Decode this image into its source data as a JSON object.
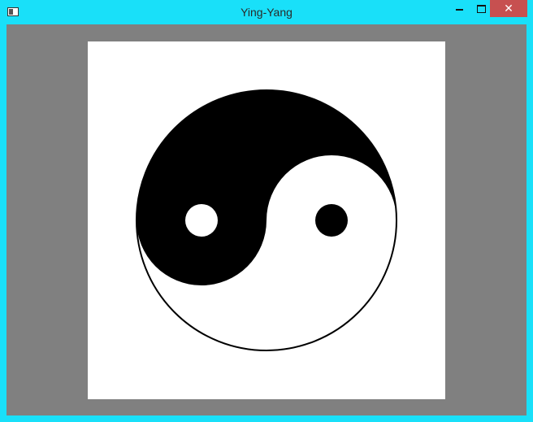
{
  "window": {
    "title": "Ying-Yang",
    "icons": {
      "app": "application-icon",
      "minimize": "minimize-icon",
      "maximize": "maximize-icon",
      "close": "close-icon"
    },
    "close_glyph": "✕"
  },
  "colors": {
    "frame": "#19e0f9",
    "client_background": "#808080",
    "canvas_background": "#ffffff",
    "yin": "#000000",
    "yang": "#ffffff",
    "close_button": "#c75050"
  }
}
